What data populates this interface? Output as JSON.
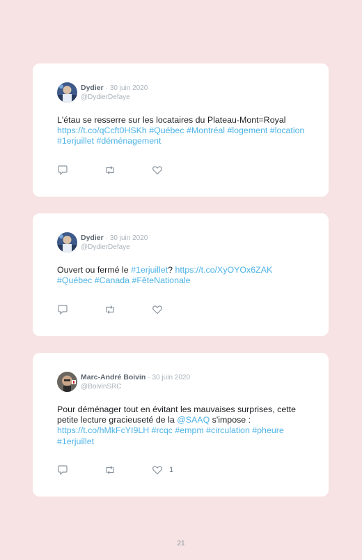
{
  "tweets": [
    {
      "author": "Dydier",
      "separator": "·",
      "date": "30 juin 2020",
      "handle": "@DydierDefaye",
      "text_plain": "L'étau se resserre sur les locataires du Plateau-Mont=Royal",
      "text_links": "https://t.co/qCcft0HSKh #Québec #Montréal #logement #location #1erjuillet #déménagement",
      "likes": ""
    },
    {
      "author": "Dydier",
      "separator": "·",
      "date": "30 juin 2020",
      "handle": "@DydierDefaye",
      "text_plain": "Ouvert ou fermé le ",
      "text_link_1": "#1erjuillet",
      "text_plain_2": "? ",
      "text_links": "https://t.co/XyOYOx6ZAK #Québec #Canada #FêteNationale",
      "likes": ""
    },
    {
      "author": "Marc-André Boivin",
      "separator": "·",
      "date": "30 juin 2020",
      "handle": "@BoivinSRC",
      "text_plain": "Pour déménager tout en évitant les mauvaises surprises, cette petite lecture gracieuseté de la ",
      "text_link_1": "@SAAQ",
      "text_plain_2": " s'impose :",
      "text_links": "https://t.co/hMkFcYI9LH #rcqc #empm #circulation #pheure #1erjuillet",
      "likes": "1"
    }
  ],
  "page_number": "21",
  "icons": [
    "reply-icon",
    "retweet-icon",
    "like-icon"
  ],
  "colors": {
    "background": "#f7e3e3",
    "link": "#4db3e6",
    "card": "#ffffff"
  }
}
